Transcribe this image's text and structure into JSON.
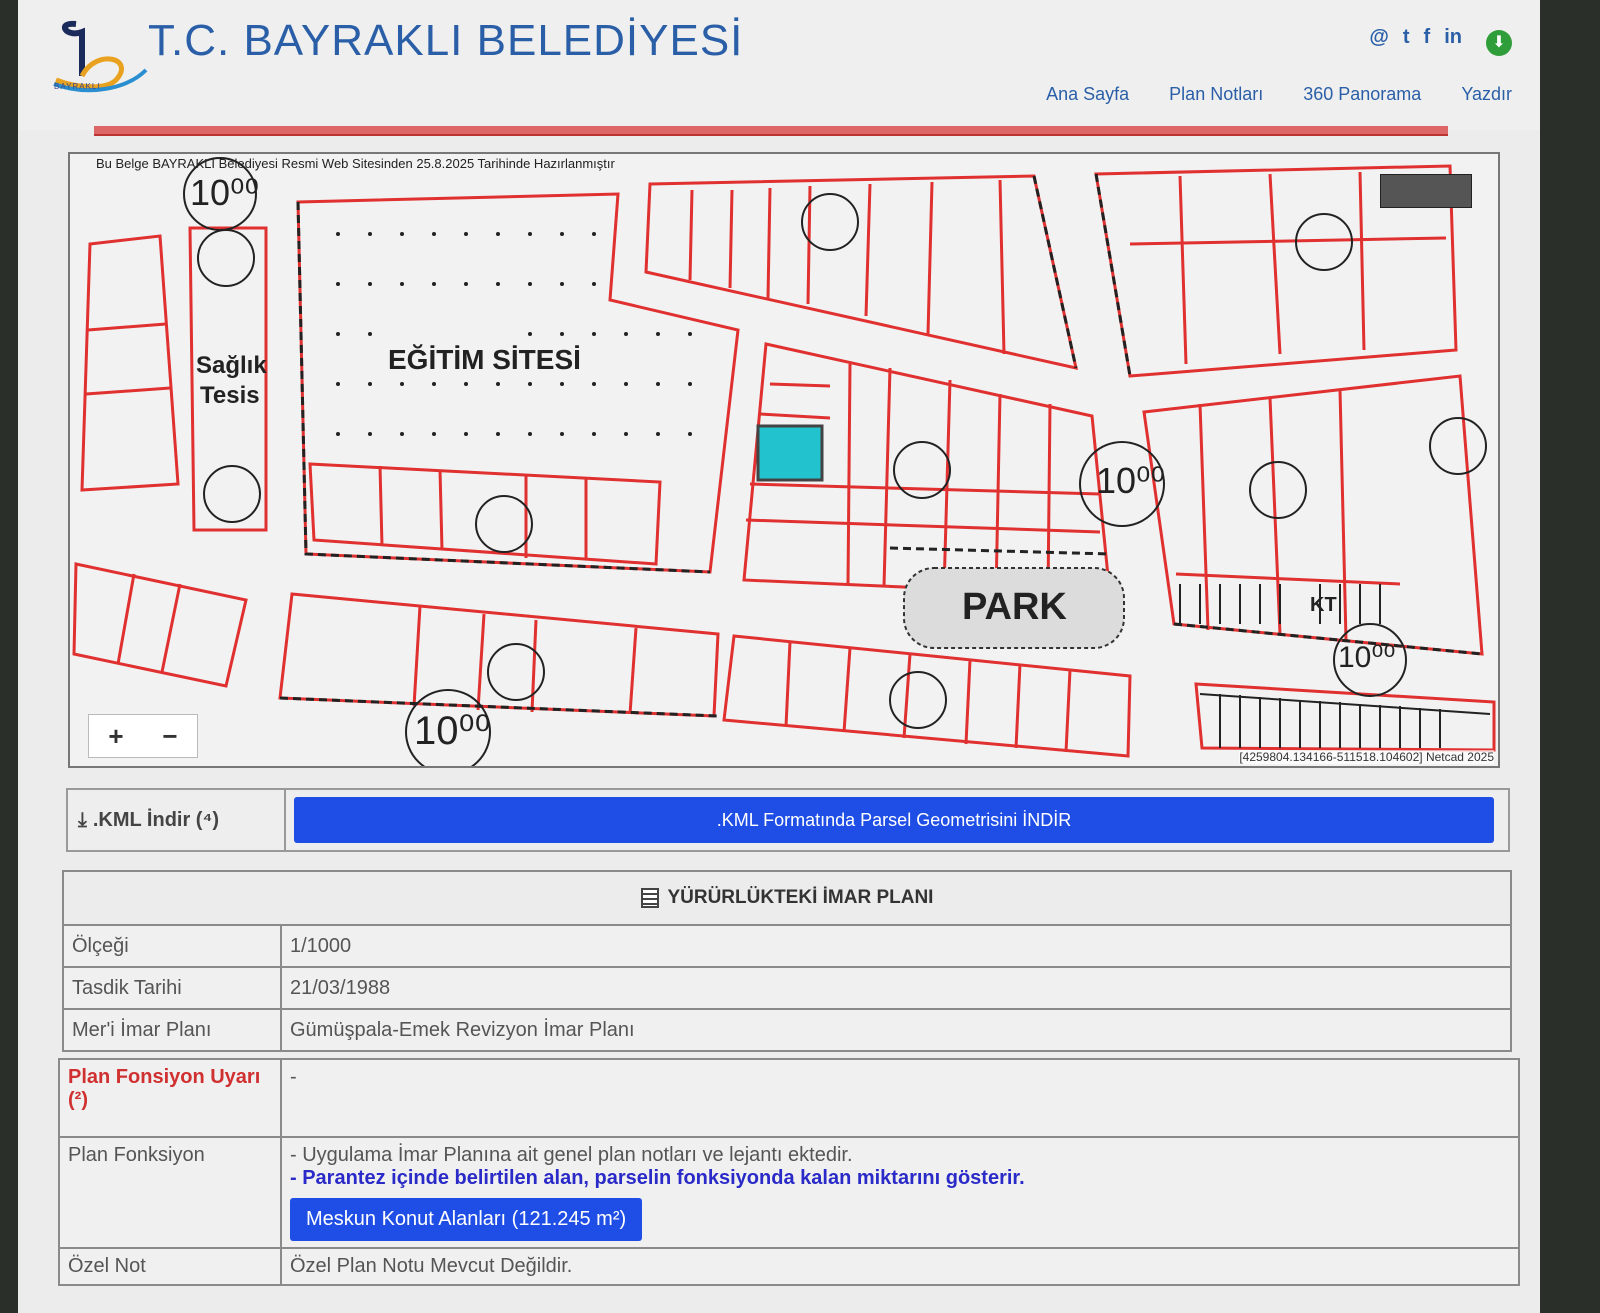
{
  "header": {
    "site_title": "T.C. BAYRAKLI BELEDİYESİ",
    "logo_text": "BAYRAKLI",
    "social": [
      "@",
      "t",
      "f",
      "in"
    ],
    "nav": [
      "Ana Sayfa",
      "Plan Notları",
      "360 Panorama",
      "Yazdır"
    ]
  },
  "map": {
    "note": "Bu Belge BAYRAKLI Belediyesi Resmi Web Sitesinden 25.8.2025 Tarihinde Hazırlanmıştır",
    "labels": {
      "school": "EĞİTİM SİTESİ",
      "health1": "Sağlık",
      "health2": "Tesis",
      "park": "PARK",
      "kt": "KT",
      "road1": "10⁰⁰",
      "road2": "10⁰⁰",
      "road3": "10⁰⁰",
      "road4": "10⁰⁰"
    },
    "zoom_in": "+",
    "zoom_out": "−",
    "coords": "[4259804.134166-511518.104602] Netcad 2025",
    "highlight_color": "#22c3cf"
  },
  "kml": {
    "label": ".KML İndir (⁴)",
    "button": ".KML Formatında Parsel Geometrisini İNDİR"
  },
  "imar": {
    "title": "YÜRÜRLÜKTEKİ İMAR PLANI",
    "rows": [
      {
        "key": "Ölçeği",
        "value": "1/1000"
      },
      {
        "key": "Tasdik Tarihi",
        "value": "21/03/1988"
      },
      {
        "key": "Mer'i İmar Planı",
        "value": "Gümüşpala-Emek Revizyon İmar Planı"
      }
    ]
  },
  "plan": {
    "warning_key": "Plan Fonsiyon Uyarı (²)",
    "warning_value": "-",
    "function_key": "Plan Fonksiyon",
    "function_note": "- Uygulama İmar Planına ait genel plan notları ve lejantı ektedir.",
    "function_note2": "- Parantez içinde belirtilen alan, parselin fonksiyonda kalan miktarını gösterir.",
    "function_button": "Meskun Konut Alanları (121.245 m²)",
    "ozel_key": "Özel Not",
    "ozel_value": "Özel Plan Notu Mevcut Değildir."
  },
  "colors": {
    "accent": "#1f4ee6",
    "title": "#2a5fa8",
    "parcel": "#e03030"
  }
}
